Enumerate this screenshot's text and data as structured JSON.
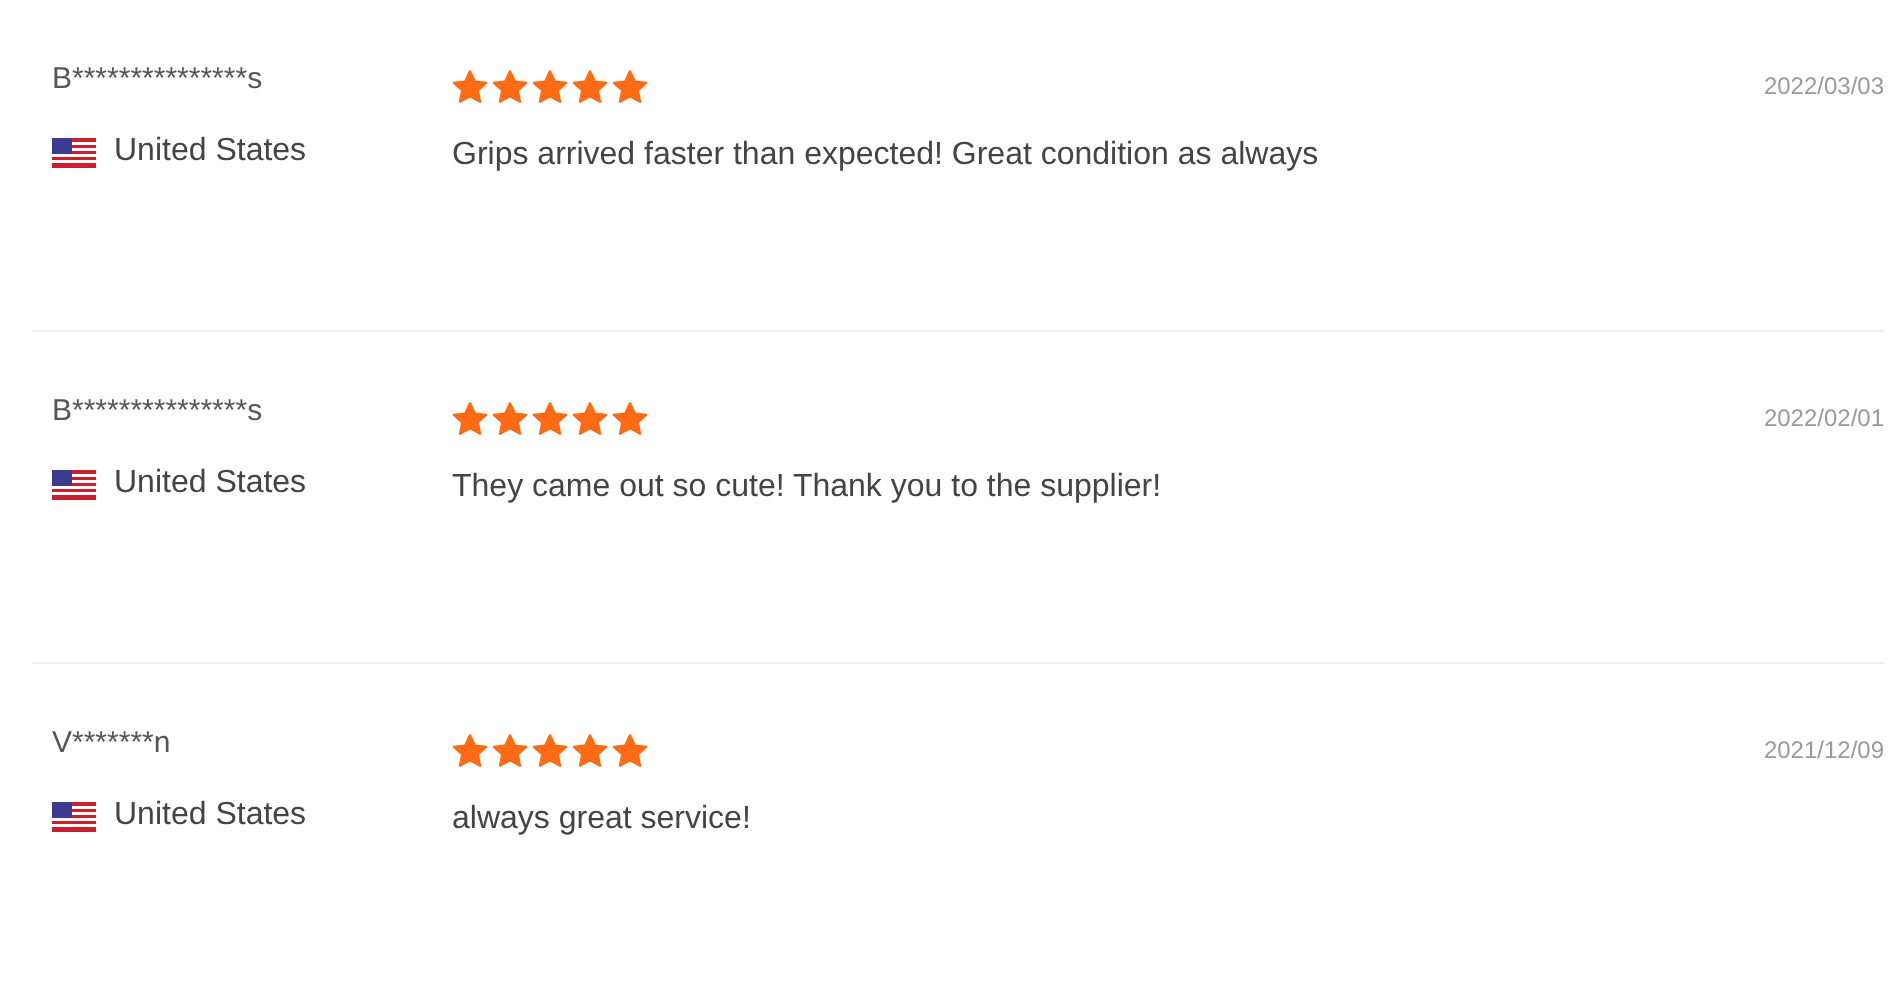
{
  "reviews": [
    {
      "name": "B***************s",
      "country": "United States",
      "stars": 5,
      "date": "2022/03/03",
      "text": "Grips arrived faster than expected! Great condition as always"
    },
    {
      "name": "B***************s",
      "country": "United States",
      "stars": 5,
      "date": "2022/02/01",
      "text": "They came out so cute! Thank you to the supplier!"
    },
    {
      "name": "V*******n",
      "country": "United States",
      "stars": 5,
      "date": "2021/12/09",
      "text": "always great service!"
    }
  ]
}
